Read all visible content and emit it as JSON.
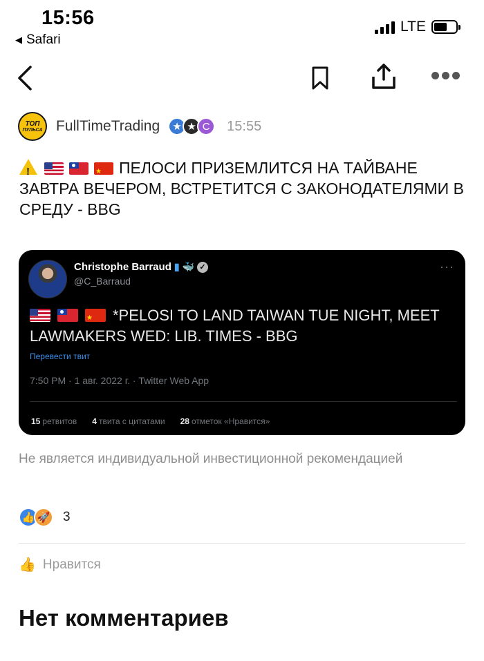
{
  "status_bar": {
    "time": "15:56",
    "back_app": "Safari",
    "network": "LTE"
  },
  "post": {
    "channel": "FullTimeTrading",
    "time": "15:55",
    "avatar_text_1": "ТОП",
    "avatar_text_2": "ПУЛЬСА",
    "title": "ПЕЛОСИ ПРИЗЕМЛИТСЯ НА ТАЙВАНЕ ЗАВТРА ВЕЧЕРОМ, ВСТРЕТИТСЯ С ЗАКОНОДАТЕЛЯМИ В СРЕДУ - BBG"
  },
  "tweet": {
    "name": "Christophe Barraud",
    "handle": "@C_Barraud",
    "text": "*PELOSI TO LAND TAIWAN TUE NIGHT, MEET LAWMAKERS WED: LIB. TIMES - BBG",
    "translate": "Перевести твит",
    "meta": "7:50 PM · 1 авг. 2022 г. · Twitter Web App",
    "stats": [
      {
        "count": "15",
        "label": "ретвитов"
      },
      {
        "count": "4",
        "label": "твита с цитатами"
      },
      {
        "count": "28",
        "label": "отметок «Нравится»"
      }
    ]
  },
  "disclaimer": "Не является индивидуальной инвестиционной рекомендацией",
  "reactions": {
    "count": "3"
  },
  "like_label": "Нравится",
  "comments_heading": "Нет комментариев",
  "colors": {
    "accent_blue": "#3a85e8",
    "badge_purple": "#9b59d6",
    "tweet_bg": "#000000",
    "link_blue": "#3a8ee6"
  }
}
